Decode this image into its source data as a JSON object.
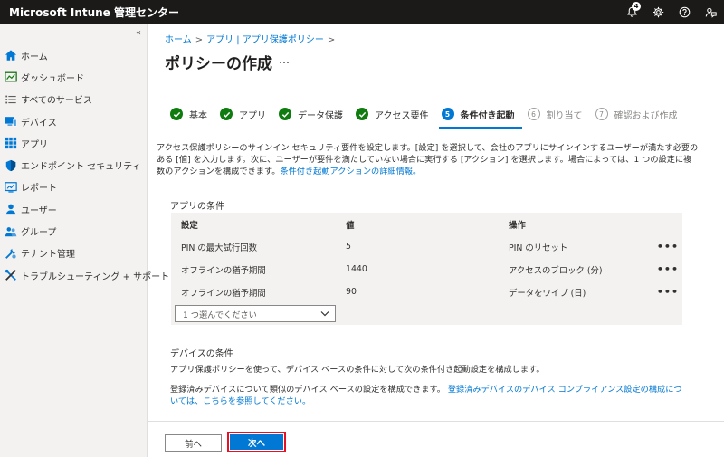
{
  "app": {
    "title": "Microsoft Intune 管理センター",
    "notification_count": "4"
  },
  "sidebar": {
    "collapse_glyph": "«",
    "items": [
      {
        "label": "ホーム",
        "icon": "home-icon"
      },
      {
        "label": "ダッシュボード",
        "icon": "dashboard-icon"
      },
      {
        "label": "すべてのサービス",
        "icon": "list-icon"
      },
      {
        "label": "デバイス",
        "icon": "devices-icon"
      },
      {
        "label": "アプリ",
        "icon": "apps-icon"
      },
      {
        "label": "エンドポイント セキュリティ",
        "icon": "shield-icon"
      },
      {
        "label": "レポート",
        "icon": "reports-icon"
      },
      {
        "label": "ユーザー",
        "icon": "user-icon"
      },
      {
        "label": "グループ",
        "icon": "groups-icon"
      },
      {
        "label": "テナント管理",
        "icon": "tenant-icon"
      },
      {
        "label": "トラブルシューティング + サポート",
        "icon": "tools-icon"
      }
    ]
  },
  "breadcrumb": {
    "items": [
      "ホーム",
      "アプリ | アプリ保護ポリシー"
    ]
  },
  "page": {
    "title": "ポリシーの作成",
    "more": "…"
  },
  "steps": [
    {
      "num": "1",
      "label": "基本",
      "state": "done"
    },
    {
      "num": "2",
      "label": "アプリ",
      "state": "done"
    },
    {
      "num": "3",
      "label": "データ保護",
      "state": "done"
    },
    {
      "num": "4",
      "label": "アクセス要件",
      "state": "done"
    },
    {
      "num": "5",
      "label": "条件付き起動",
      "state": "current"
    },
    {
      "num": "6",
      "label": "割り当て",
      "state": "future"
    },
    {
      "num": "7",
      "label": "確認および作成",
      "state": "future"
    }
  ],
  "description": {
    "text": "アクセス保護ポリシーのサインイン セキュリティ要件を設定します。[設定] を選択して、会社のアプリにサインインするユーザーが満たす必要のある [値] を入力します。次に、ユーザーが要件を満たしていない場合に実行する [アクション] を選択します。場合によっては、1 つの設定に複数のアクションを構成できます。",
    "link": "条件付き起動アクションの詳細情報。"
  },
  "app_conditions": {
    "title": "アプリの条件",
    "headers": [
      "設定",
      "値",
      "操作"
    ],
    "rows": [
      {
        "setting": "PIN の最大試行回数",
        "value": "5",
        "action": "PIN のリセット"
      },
      {
        "setting": "オフラインの猶予期間",
        "value": "1440",
        "action": "アクセスのブロック (分)"
      },
      {
        "setting": "オフラインの猶予期間",
        "value": "90",
        "action": "データをワイプ (日)"
      }
    ],
    "more": "•••",
    "select_placeholder": "1 つ選んでください"
  },
  "device_conditions": {
    "title": "デバイスの条件",
    "text1": "アプリ保護ポリシーを使って、デバイス ベースの条件に対して次の条件付き起動設定を構成します。",
    "text2": "登録済みデバイスについて類似のデバイス ベースの設定を構成できます。",
    "link": "登録済みデバイスのデバイス コンプライアンス設定の構成については、こちらを参照してください。"
  },
  "footer": {
    "prev_label": "前へ",
    "next_label": "次へ"
  },
  "colors": {
    "accent": "#0078d4",
    "done": "#107c10",
    "highlight": "#e81123",
    "topbar": "#1b1a19"
  }
}
